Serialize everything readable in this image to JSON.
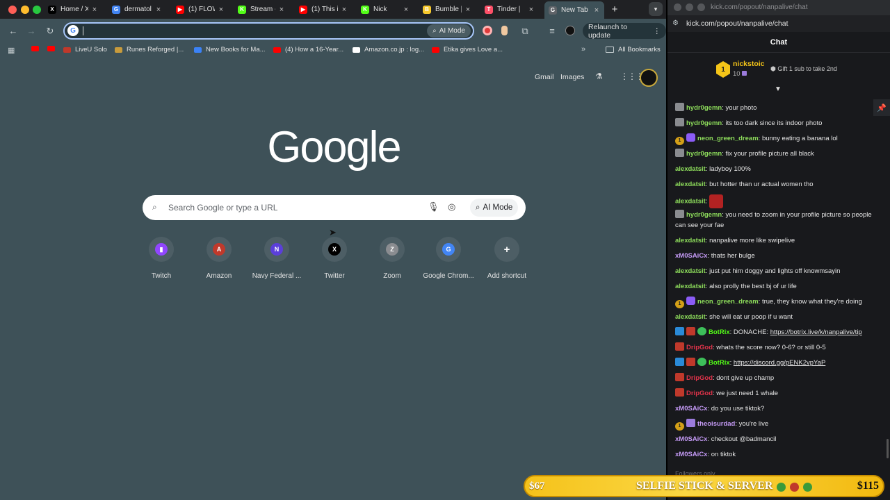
{
  "browser": {
    "tabs": [
      {
        "label": "Home / X",
        "fav": "X",
        "fav_color": "#000000"
      },
      {
        "label": "dermatol",
        "fav": "G",
        "fav_color": "#4285f4"
      },
      {
        "label": "(1) FLOW",
        "fav": "▶",
        "fav_color": "#ff0000"
      },
      {
        "label": "Stream -",
        "fav": "K",
        "fav_color": "#53fc18"
      },
      {
        "label": "(1) This i",
        "fav": "▶",
        "fav_color": "#ff0000"
      },
      {
        "label": "Nick",
        "fav": "K",
        "fav_color": "#53fc18"
      },
      {
        "label": "Bumble |",
        "fav": "B",
        "fav_color": "#f7c92d"
      },
      {
        "label": "Tinder | ",
        "fav": "T",
        "fav_color": "#fd5068"
      },
      {
        "label": "New Tab",
        "fav": "G",
        "fav_color": "#5f6368"
      }
    ],
    "tab_close_glyph": "×",
    "newtab_glyph": "+",
    "omnibox": {
      "value": "",
      "ai_mode_label": "AI Mode"
    },
    "relaunch_label": "Relaunch to update",
    "bookmarks": [
      {
        "label": "",
        "color": "#ff0000"
      },
      {
        "label": "",
        "color": "#ff0000"
      },
      {
        "label": "LiveU Solo",
        "color": "#c0392b"
      },
      {
        "label": "Runes Reforged |...",
        "color": "#c89b3c"
      },
      {
        "label": "New Books for Ma...",
        "color": "#3b82f6"
      },
      {
        "label": "(4) How a 16-Year...",
        "color": "#ff0000"
      },
      {
        "label": "Amazon.co.jp : log...",
        "color": "#ffffff"
      },
      {
        "label": "Etika gives Love a...",
        "color": "#ff0000"
      }
    ],
    "all_bookmarks_label": "All Bookmarks"
  },
  "ntp": {
    "gmail_label": "Gmail",
    "images_label": "Images",
    "logo_text": "Google",
    "search_placeholder": "Search Google or type a URL",
    "ai_mode_label": "AI Mode",
    "shortcuts": [
      {
        "label": "Twitch",
        "glyph": "▮",
        "color": "#9146ff"
      },
      {
        "label": "Amazon",
        "glyph": "A",
        "color": "#c0392b"
      },
      {
        "label": "Navy Federal ...",
        "glyph": "N",
        "color": "#5b3fd9"
      },
      {
        "label": "Twitter",
        "glyph": "X",
        "color": "#000000"
      },
      {
        "label": "Zoom",
        "glyph": "Z",
        "color": "#8a8c90"
      },
      {
        "label": "Google Chrom...",
        "glyph": "G",
        "color": "#4285f4"
      },
      {
        "label": "Add shortcut",
        "glyph": "+",
        "color": "#4d5e65"
      }
    ]
  },
  "kick": {
    "window_title": "kick.com/popout/nanpalive/chat",
    "url": "kick.com/popout/nanpalive/chat",
    "chat_title": "Chat",
    "pinned": {
      "rank": "1",
      "user": "nickstoic",
      "count": "10",
      "gift_text": "Gift 1 sub to take 2nd"
    },
    "messages": [
      {
        "badges": [
          "gray"
        ],
        "user": "hydr0gemn",
        "color": "#8ddc5b",
        "text": "your photo"
      },
      {
        "badges": [
          "gray"
        ],
        "user": "hydr0gemn",
        "color": "#8ddc5b",
        "text": "its too dark since its indoor photo"
      },
      {
        "badges": [
          "gold",
          "purple"
        ],
        "user": "neon_green_dream",
        "color": "#8ddc5b",
        "text": "bunny eating a banana lol"
      },
      {
        "badges": [
          "gray"
        ],
        "user": "hydr0gemn",
        "color": "#8ddc5b",
        "text": "fix your profile picture all black"
      },
      {
        "badges": [],
        "user": "alexdatsit",
        "color": "#8ddc5b",
        "text": "ladyboy 100%"
      },
      {
        "badges": [],
        "user": "alexdatsit",
        "color": "#8ddc5b",
        "text": "but hotter than ur actual women tho"
      },
      {
        "badges": [],
        "user": "alexdatsit",
        "color": "#8ddc5b",
        "text": "",
        "emote": true
      },
      {
        "badges": [
          "gray"
        ],
        "user": "hydr0gemn",
        "color": "#8ddc5b",
        "text": "you need to zoom in your profile picture so people can see your fae"
      },
      {
        "badges": [],
        "user": "alexdatsit",
        "color": "#8ddc5b",
        "text": "nanpalive more like swipelive"
      },
      {
        "badges": [],
        "user": "xM0SAiCx",
        "color": "#c49af5",
        "text": "thats her bulge"
      },
      {
        "badges": [],
        "user": "alexdatsit",
        "color": "#8ddc5b",
        "text": "just put him doggy and lights off knowmsayin"
      },
      {
        "badges": [],
        "user": "alexdatsit",
        "color": "#8ddc5b",
        "text": "also prolly the best bj of ur life"
      },
      {
        "badges": [
          "gold",
          "purple"
        ],
        "user": "neon_green_dream",
        "color": "#8ddc5b",
        "text": "true, they know what they're doing"
      },
      {
        "badges": [],
        "user": "alexdatsit",
        "color": "#8ddc5b",
        "text": "she will eat ur poop if u want"
      },
      {
        "badges": [
          "blue",
          "red",
          "check"
        ],
        "user": "BotRix",
        "color": "#53fc18",
        "text": "DONACHE: ",
        "link": "https://botrix.live/k/nanpalive/tip"
      },
      {
        "badges": [
          "red"
        ],
        "user": "DripGod",
        "color": "#e0334a",
        "text": "whats the score now? 0-6? or still 0-5"
      },
      {
        "badges": [
          "blue",
          "red",
          "check"
        ],
        "user": "BotRix",
        "color": "#53fc18",
        "text": "",
        "link": "https://discord.gg/pENK2vpYaP"
      },
      {
        "badges": [
          "red"
        ],
        "user": "DripGod",
        "color": "#e0334a",
        "text": "dont give up champ"
      },
      {
        "badges": [
          "red"
        ],
        "user": "DripGod",
        "color": "#e0334a",
        "text": "we just need 1 whale"
      },
      {
        "badges": [],
        "user": "xM0SAiCx",
        "color": "#c49af5",
        "text": "do you use tiktok?"
      },
      {
        "badges": [
          "gold",
          "sub"
        ],
        "user": "theoisurdad",
        "color": "#c49af5",
        "text": "you're live"
      },
      {
        "badges": [],
        "user": "xM0SAiCx",
        "color": "#c49af5",
        "text": "checkout @badmancil"
      },
      {
        "badges": [],
        "user": "xM0SAiCx",
        "color": "#c49af5",
        "text": "on tiktok"
      }
    ],
    "followers_only": "Followers only"
  },
  "overlay": {
    "left_amount": "$67",
    "goal_text": "SELFIE STICK & SERVER",
    "right_amount": "$115"
  }
}
